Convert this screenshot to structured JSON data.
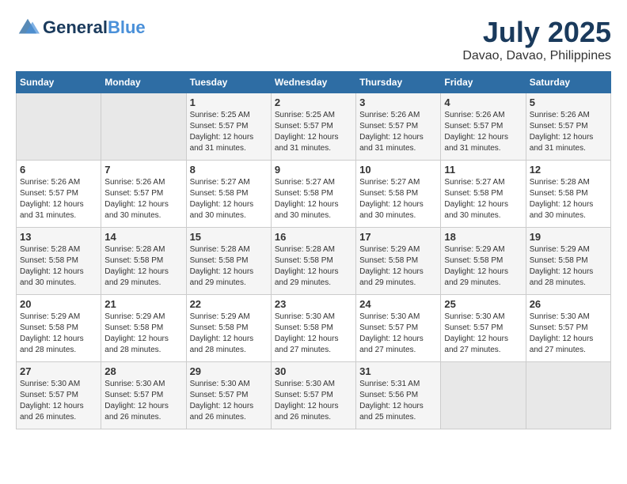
{
  "header": {
    "logo_line1": "General",
    "logo_line2": "Blue",
    "month_year": "July 2025",
    "location": "Davao, Davao, Philippines"
  },
  "weekdays": [
    "Sunday",
    "Monday",
    "Tuesday",
    "Wednesday",
    "Thursday",
    "Friday",
    "Saturday"
  ],
  "weeks": [
    [
      {
        "day": "",
        "sunrise": "",
        "sunset": "",
        "daylight": ""
      },
      {
        "day": "",
        "sunrise": "",
        "sunset": "",
        "daylight": ""
      },
      {
        "day": "1",
        "sunrise": "Sunrise: 5:25 AM",
        "sunset": "Sunset: 5:57 PM",
        "daylight": "Daylight: 12 hours and 31 minutes."
      },
      {
        "day": "2",
        "sunrise": "Sunrise: 5:25 AM",
        "sunset": "Sunset: 5:57 PM",
        "daylight": "Daylight: 12 hours and 31 minutes."
      },
      {
        "day": "3",
        "sunrise": "Sunrise: 5:26 AM",
        "sunset": "Sunset: 5:57 PM",
        "daylight": "Daylight: 12 hours and 31 minutes."
      },
      {
        "day": "4",
        "sunrise": "Sunrise: 5:26 AM",
        "sunset": "Sunset: 5:57 PM",
        "daylight": "Daylight: 12 hours and 31 minutes."
      },
      {
        "day": "5",
        "sunrise": "Sunrise: 5:26 AM",
        "sunset": "Sunset: 5:57 PM",
        "daylight": "Daylight: 12 hours and 31 minutes."
      }
    ],
    [
      {
        "day": "6",
        "sunrise": "Sunrise: 5:26 AM",
        "sunset": "Sunset: 5:57 PM",
        "daylight": "Daylight: 12 hours and 31 minutes."
      },
      {
        "day": "7",
        "sunrise": "Sunrise: 5:26 AM",
        "sunset": "Sunset: 5:57 PM",
        "daylight": "Daylight: 12 hours and 30 minutes."
      },
      {
        "day": "8",
        "sunrise": "Sunrise: 5:27 AM",
        "sunset": "Sunset: 5:58 PM",
        "daylight": "Daylight: 12 hours and 30 minutes."
      },
      {
        "day": "9",
        "sunrise": "Sunrise: 5:27 AM",
        "sunset": "Sunset: 5:58 PM",
        "daylight": "Daylight: 12 hours and 30 minutes."
      },
      {
        "day": "10",
        "sunrise": "Sunrise: 5:27 AM",
        "sunset": "Sunset: 5:58 PM",
        "daylight": "Daylight: 12 hours and 30 minutes."
      },
      {
        "day": "11",
        "sunrise": "Sunrise: 5:27 AM",
        "sunset": "Sunset: 5:58 PM",
        "daylight": "Daylight: 12 hours and 30 minutes."
      },
      {
        "day": "12",
        "sunrise": "Sunrise: 5:28 AM",
        "sunset": "Sunset: 5:58 PM",
        "daylight": "Daylight: 12 hours and 30 minutes."
      }
    ],
    [
      {
        "day": "13",
        "sunrise": "Sunrise: 5:28 AM",
        "sunset": "Sunset: 5:58 PM",
        "daylight": "Daylight: 12 hours and 30 minutes."
      },
      {
        "day": "14",
        "sunrise": "Sunrise: 5:28 AM",
        "sunset": "Sunset: 5:58 PM",
        "daylight": "Daylight: 12 hours and 29 minutes."
      },
      {
        "day": "15",
        "sunrise": "Sunrise: 5:28 AM",
        "sunset": "Sunset: 5:58 PM",
        "daylight": "Daylight: 12 hours and 29 minutes."
      },
      {
        "day": "16",
        "sunrise": "Sunrise: 5:28 AM",
        "sunset": "Sunset: 5:58 PM",
        "daylight": "Daylight: 12 hours and 29 minutes."
      },
      {
        "day": "17",
        "sunrise": "Sunrise: 5:29 AM",
        "sunset": "Sunset: 5:58 PM",
        "daylight": "Daylight: 12 hours and 29 minutes."
      },
      {
        "day": "18",
        "sunrise": "Sunrise: 5:29 AM",
        "sunset": "Sunset: 5:58 PM",
        "daylight": "Daylight: 12 hours and 29 minutes."
      },
      {
        "day": "19",
        "sunrise": "Sunrise: 5:29 AM",
        "sunset": "Sunset: 5:58 PM",
        "daylight": "Daylight: 12 hours and 28 minutes."
      }
    ],
    [
      {
        "day": "20",
        "sunrise": "Sunrise: 5:29 AM",
        "sunset": "Sunset: 5:58 PM",
        "daylight": "Daylight: 12 hours and 28 minutes."
      },
      {
        "day": "21",
        "sunrise": "Sunrise: 5:29 AM",
        "sunset": "Sunset: 5:58 PM",
        "daylight": "Daylight: 12 hours and 28 minutes."
      },
      {
        "day": "22",
        "sunrise": "Sunrise: 5:29 AM",
        "sunset": "Sunset: 5:58 PM",
        "daylight": "Daylight: 12 hours and 28 minutes."
      },
      {
        "day": "23",
        "sunrise": "Sunrise: 5:30 AM",
        "sunset": "Sunset: 5:58 PM",
        "daylight": "Daylight: 12 hours and 27 minutes."
      },
      {
        "day": "24",
        "sunrise": "Sunrise: 5:30 AM",
        "sunset": "Sunset: 5:57 PM",
        "daylight": "Daylight: 12 hours and 27 minutes."
      },
      {
        "day": "25",
        "sunrise": "Sunrise: 5:30 AM",
        "sunset": "Sunset: 5:57 PM",
        "daylight": "Daylight: 12 hours and 27 minutes."
      },
      {
        "day": "26",
        "sunrise": "Sunrise: 5:30 AM",
        "sunset": "Sunset: 5:57 PM",
        "daylight": "Daylight: 12 hours and 27 minutes."
      }
    ],
    [
      {
        "day": "27",
        "sunrise": "Sunrise: 5:30 AM",
        "sunset": "Sunset: 5:57 PM",
        "daylight": "Daylight: 12 hours and 26 minutes."
      },
      {
        "day": "28",
        "sunrise": "Sunrise: 5:30 AM",
        "sunset": "Sunset: 5:57 PM",
        "daylight": "Daylight: 12 hours and 26 minutes."
      },
      {
        "day": "29",
        "sunrise": "Sunrise: 5:30 AM",
        "sunset": "Sunset: 5:57 PM",
        "daylight": "Daylight: 12 hours and 26 minutes."
      },
      {
        "day": "30",
        "sunrise": "Sunrise: 5:30 AM",
        "sunset": "Sunset: 5:57 PM",
        "daylight": "Daylight: 12 hours and 26 minutes."
      },
      {
        "day": "31",
        "sunrise": "Sunrise: 5:31 AM",
        "sunset": "Sunset: 5:56 PM",
        "daylight": "Daylight: 12 hours and 25 minutes."
      },
      {
        "day": "",
        "sunrise": "",
        "sunset": "",
        "daylight": ""
      },
      {
        "day": "",
        "sunrise": "",
        "sunset": "",
        "daylight": ""
      }
    ]
  ]
}
